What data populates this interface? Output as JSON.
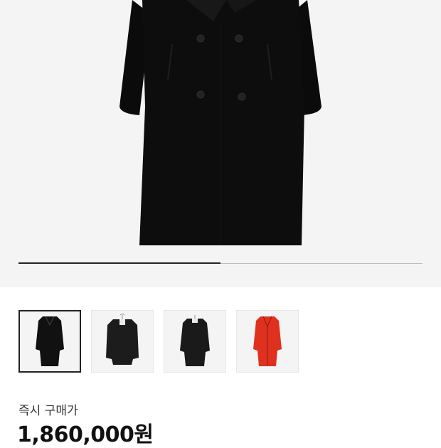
{
  "gallery": {
    "progress_fraction": 0.5,
    "thumbnails": [
      {
        "color": "#111111",
        "icon": "long-coat-front",
        "selected": true
      },
      {
        "color": "#1c1c1c",
        "icon": "short-coat-hanger",
        "selected": false
      },
      {
        "color": "#1a1a1a",
        "icon": "long-coat-hanger",
        "selected": false
      },
      {
        "color": "#e0311f",
        "icon": "long-coat-front",
        "selected": false
      }
    ]
  },
  "price": {
    "label": "즉시 구매가",
    "value": "1,860,000원"
  }
}
